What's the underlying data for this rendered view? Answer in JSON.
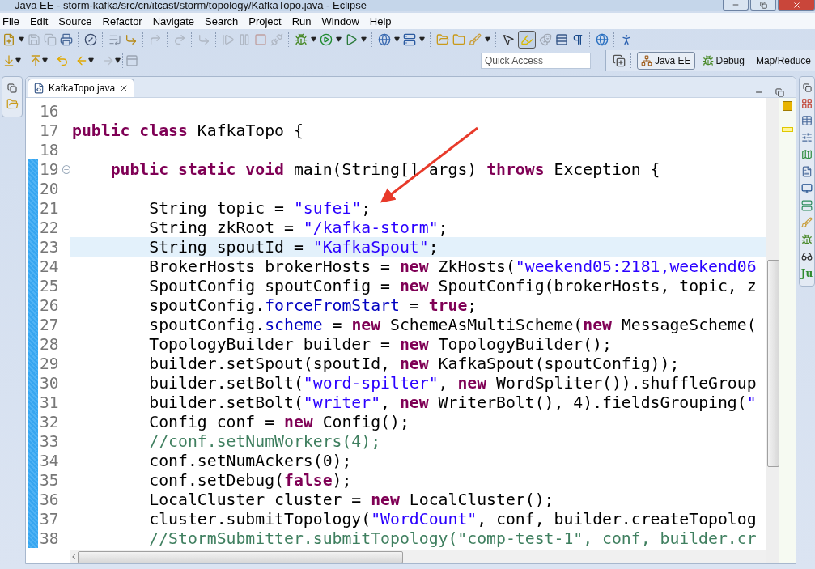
{
  "window": {
    "title": "Java EE - storm-kafka/src/cn/itcast/storm/topology/KafkaTopo.java - Eclipse"
  },
  "menu": [
    "File",
    "Edit",
    "Source",
    "Refactor",
    "Navigate",
    "Search",
    "Project",
    "Run",
    "Window",
    "Help"
  ],
  "toolbar": {
    "highlighter_toggle_on": true
  },
  "quick_access": {
    "placeholder": "Quick Access"
  },
  "perspectives": [
    {
      "label": "Java EE",
      "selected": true,
      "kind": "javaee"
    },
    {
      "label": "Debug",
      "selected": false,
      "kind": "debug"
    },
    {
      "label": "Map/Reduce",
      "selected": false,
      "kind": "plain"
    }
  ],
  "right_trim": {
    "junit_text": "Ju"
  },
  "editor": {
    "tabs": [
      {
        "label": "KafkaTopo.java",
        "selected": true
      }
    ],
    "lines": [
      {
        "number": "16",
        "changed": false,
        "current": false
      },
      {
        "number": "17",
        "changed": false,
        "current": false,
        "tokens": [
          {
            "kind": "kw",
            "text": "public class"
          },
          {
            "kind": "plain",
            "text": " KafkaTopo {"
          }
        ]
      },
      {
        "number": "18",
        "changed": false,
        "current": false
      },
      {
        "number": "19",
        "changed": true,
        "current": false,
        "foldable": true,
        "tokens": [
          {
            "kind": "kw",
            "text": "    public static void"
          },
          {
            "kind": "plain",
            "text": " main(String[] args) "
          },
          {
            "kind": "kw",
            "text": "throws"
          },
          {
            "kind": "plain",
            "text": " Exception {"
          }
        ]
      },
      {
        "number": "20",
        "changed": true,
        "current": false
      },
      {
        "number": "21",
        "changed": true,
        "current": false,
        "tokens": [
          {
            "kind": "plain",
            "text": "        String topic = "
          },
          {
            "kind": "str",
            "text": "\"sufei\""
          },
          {
            "kind": "plain",
            "text": ";"
          }
        ]
      },
      {
        "number": "22",
        "changed": true,
        "current": false,
        "tokens": [
          {
            "kind": "plain",
            "text": "        String zkRoot = "
          },
          {
            "kind": "str",
            "text": "\"/kafka-storm\""
          },
          {
            "kind": "plain",
            "text": ";"
          }
        ]
      },
      {
        "number": "23",
        "changed": true,
        "current": true,
        "tokens": [
          {
            "kind": "plain",
            "text": "        String spoutId = "
          },
          {
            "kind": "str",
            "text": "\"KafkaSpout\""
          },
          {
            "kind": "plain",
            "text": ";"
          }
        ]
      },
      {
        "number": "24",
        "changed": true,
        "current": false,
        "tokens": [
          {
            "kind": "plain",
            "text": "        BrokerHosts brokerHosts = "
          },
          {
            "kind": "kw",
            "text": "new"
          },
          {
            "kind": "plain",
            "text": " ZkHosts("
          },
          {
            "kind": "str",
            "text": "\"weekend05:2181,weekend06"
          }
        ]
      },
      {
        "number": "25",
        "changed": true,
        "current": false,
        "tokens": [
          {
            "kind": "plain",
            "text": "        SpoutConfig spoutConfig = "
          },
          {
            "kind": "kw",
            "text": "new"
          },
          {
            "kind": "plain",
            "text": " SpoutConfig(brokerHosts, topic, z"
          }
        ]
      },
      {
        "number": "26",
        "changed": true,
        "current": false,
        "tokens": [
          {
            "kind": "plain",
            "text": "        spoutConfig."
          },
          {
            "kind": "field",
            "text": "forceFromStart"
          },
          {
            "kind": "plain",
            "text": " = "
          },
          {
            "kind": "kw",
            "text": "true"
          },
          {
            "kind": "plain",
            "text": ";"
          }
        ]
      },
      {
        "number": "27",
        "changed": true,
        "current": false,
        "tokens": [
          {
            "kind": "plain",
            "text": "        spoutConfig."
          },
          {
            "kind": "field",
            "text": "scheme"
          },
          {
            "kind": "plain",
            "text": " = "
          },
          {
            "kind": "kw",
            "text": "new"
          },
          {
            "kind": "plain",
            "text": " SchemeAsMultiScheme("
          },
          {
            "kind": "kw",
            "text": "new"
          },
          {
            "kind": "plain",
            "text": " MessageScheme("
          }
        ]
      },
      {
        "number": "28",
        "changed": true,
        "current": false,
        "tokens": [
          {
            "kind": "plain",
            "text": "        TopologyBuilder builder = "
          },
          {
            "kind": "kw",
            "text": "new"
          },
          {
            "kind": "plain",
            "text": " TopologyBuilder();"
          }
        ]
      },
      {
        "number": "29",
        "changed": true,
        "current": false,
        "tokens": [
          {
            "kind": "plain",
            "text": "        builder.setSpout(spoutId, "
          },
          {
            "kind": "kw",
            "text": "new"
          },
          {
            "kind": "plain",
            "text": " KafkaSpout(spoutConfig));"
          }
        ]
      },
      {
        "number": "30",
        "changed": true,
        "current": false,
        "tokens": [
          {
            "kind": "plain",
            "text": "        builder.setBolt("
          },
          {
            "kind": "str",
            "text": "\"word-spilter\""
          },
          {
            "kind": "plain",
            "text": ", "
          },
          {
            "kind": "kw",
            "text": "new"
          },
          {
            "kind": "plain",
            "text": " WordSpliter()).shuffleGroup"
          }
        ]
      },
      {
        "number": "31",
        "changed": true,
        "current": false,
        "tokens": [
          {
            "kind": "plain",
            "text": "        builder.setBolt("
          },
          {
            "kind": "str",
            "text": "\"writer\""
          },
          {
            "kind": "plain",
            "text": ", "
          },
          {
            "kind": "kw",
            "text": "new"
          },
          {
            "kind": "plain",
            "text": " WriterBolt(), 4).fieldsGrouping("
          },
          {
            "kind": "str",
            "text": "\""
          }
        ]
      },
      {
        "number": "32",
        "changed": true,
        "current": false,
        "tokens": [
          {
            "kind": "plain",
            "text": "        Config conf = "
          },
          {
            "kind": "kw",
            "text": "new"
          },
          {
            "kind": "plain",
            "text": " Config();"
          }
        ]
      },
      {
        "number": "33",
        "changed": true,
        "current": false,
        "tokens": [
          {
            "kind": "comment",
            "text": "        //conf.setNumWorkers(4);"
          }
        ]
      },
      {
        "number": "34",
        "changed": true,
        "current": false,
        "tokens": [
          {
            "kind": "plain",
            "text": "        conf.setNumAckers(0);"
          }
        ]
      },
      {
        "number": "35",
        "changed": true,
        "current": false,
        "tokens": [
          {
            "kind": "plain",
            "text": "        conf.setDebug("
          },
          {
            "kind": "kw",
            "text": "false"
          },
          {
            "kind": "plain",
            "text": ");"
          }
        ]
      },
      {
        "number": "36",
        "changed": true,
        "current": false,
        "tokens": [
          {
            "kind": "plain",
            "text": "        LocalCluster cluster = "
          },
          {
            "kind": "kw",
            "text": "new"
          },
          {
            "kind": "plain",
            "text": " LocalCluster();"
          }
        ]
      },
      {
        "number": "37",
        "changed": true,
        "current": false,
        "tokens": [
          {
            "kind": "plain",
            "text": "        cluster.submitTopology("
          },
          {
            "kind": "str",
            "text": "\"WordCount\""
          },
          {
            "kind": "plain",
            "text": ", conf, builder.createTopolog"
          }
        ]
      },
      {
        "number": "38",
        "changed": true,
        "current": false,
        "tokens": [
          {
            "kind": "comment",
            "text": "        //StormSubmitter.submitTopology(\"comp-test-1\", conf, builder.cr"
          }
        ]
      }
    ]
  }
}
